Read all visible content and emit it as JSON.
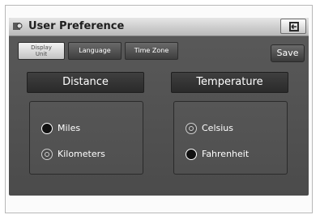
{
  "header": {
    "title": "User Preference",
    "app_icon": "settings-gear-icon",
    "back_icon": "return-back-icon"
  },
  "tabs": [
    {
      "label_line1": "Display",
      "label_line2": "Unit",
      "active": true
    },
    {
      "label": "Language",
      "active": false
    },
    {
      "label": "Time Zone",
      "active": false
    }
  ],
  "save_label": "Save",
  "distance": {
    "title": "Distance",
    "options": [
      "Miles",
      "Kilometers"
    ],
    "selected": "Miles"
  },
  "temperature": {
    "title": "Temperature",
    "options": [
      "Celsius",
      "Fahrenheit"
    ],
    "selected": "Fahrenheit"
  }
}
